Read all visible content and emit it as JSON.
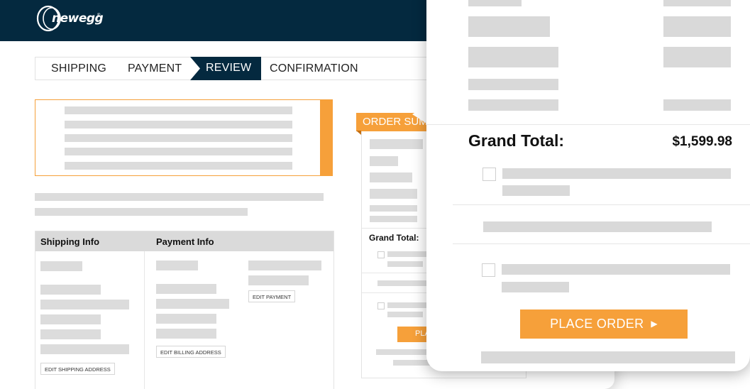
{
  "brand": {
    "logo_text": "newegg",
    "logo_mark": "newegg-logo-icon",
    "tm": "®"
  },
  "colors": {
    "navy": "#04293f",
    "orange": "#f6a03a",
    "placeholder_gray": "#dcdcdc"
  },
  "checkout_steps": [
    {
      "label": "SHIPPING",
      "active": false
    },
    {
      "label": "PAYMENT",
      "active": false
    },
    {
      "label": "REVIEW",
      "active": true
    },
    {
      "label": "CONFIRMATION",
      "active": false
    }
  ],
  "info_panel": {
    "shipping_title": "Shipping Info",
    "payment_title": "Payment Info",
    "edit_shipping_label": "EDIT SHIPPING ADDRESS",
    "edit_billing_label": "EDIT BILLING ADDRESS",
    "edit_payment_label": "EDIT PAYMENT"
  },
  "order_summary": {
    "header_label": "ORDER SUM",
    "grand_total_label": "Grand Total:",
    "place_order_partial": "PLA"
  },
  "zoom_card": {
    "grand_total_label": "Grand Total:",
    "grand_total_value": "$1,599.98",
    "place_order_label": "PLACE ORDER",
    "place_order_icon": "play-arrow-icon"
  }
}
